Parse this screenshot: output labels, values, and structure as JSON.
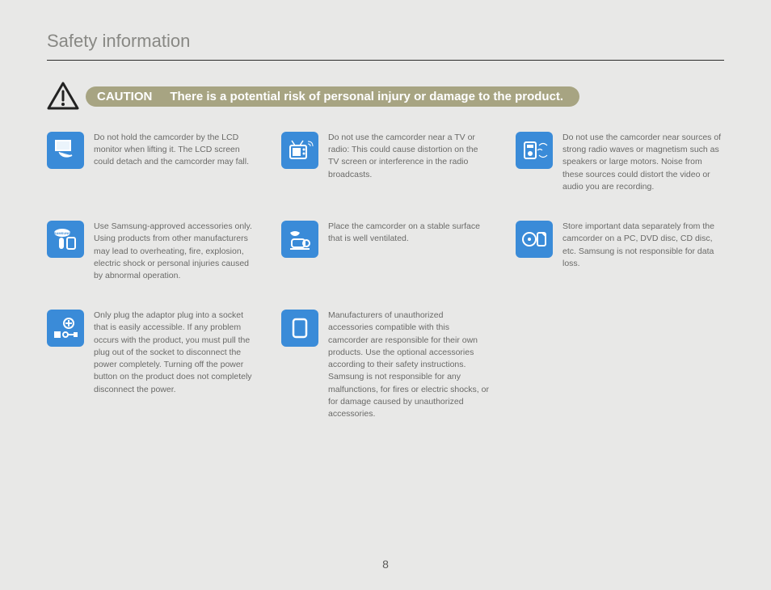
{
  "title": "Safety information",
  "caution": {
    "label": "CAUTION",
    "text": "There is a potential risk of personal injury or damage to the product."
  },
  "items": [
    {
      "text": "Do not hold the camcorder by the LCD monitor when lifting it. The LCD screen could detach and the camcorder may fall."
    },
    {
      "text": "Do not use the camcorder near a TV or radio: This could cause distortion on the TV screen or interference in the radio broadcasts."
    },
    {
      "text": "Do not use the camcorder near sources of strong radio waves or magnetism such as speakers or large motors. Noise from these sources could distort the video or audio you are recording."
    },
    {
      "text": "Use Samsung-approved accessories only. Using products from other manufacturers may lead to overheating, fire, explosion, electric shock or personal injuries caused by abnormal operation."
    },
    {
      "text": "Place the camcorder on a stable surface that is well ventilated."
    },
    {
      "text": "Store important data separately from the camcorder on a PC, DVD disc, CD disc, etc. Samsung is not responsible for data loss."
    },
    {
      "text": "Only plug the adaptor plug into a socket that is easily accessible. If any problem occurs with the product, you must pull the plug out of the socket to disconnect the power completely. Turning off the power button on the product does not completely disconnect the power."
    },
    {
      "text": "Manufacturers of unauthorized accessories compatible with this camcorder are responsible for their own products. Use the optional accessories according to their safety instructions. Samsung is not responsible for any malfunctions, for fires or electric shocks, or for damage caused by unauthorized accessories."
    }
  ],
  "page_number": "8"
}
